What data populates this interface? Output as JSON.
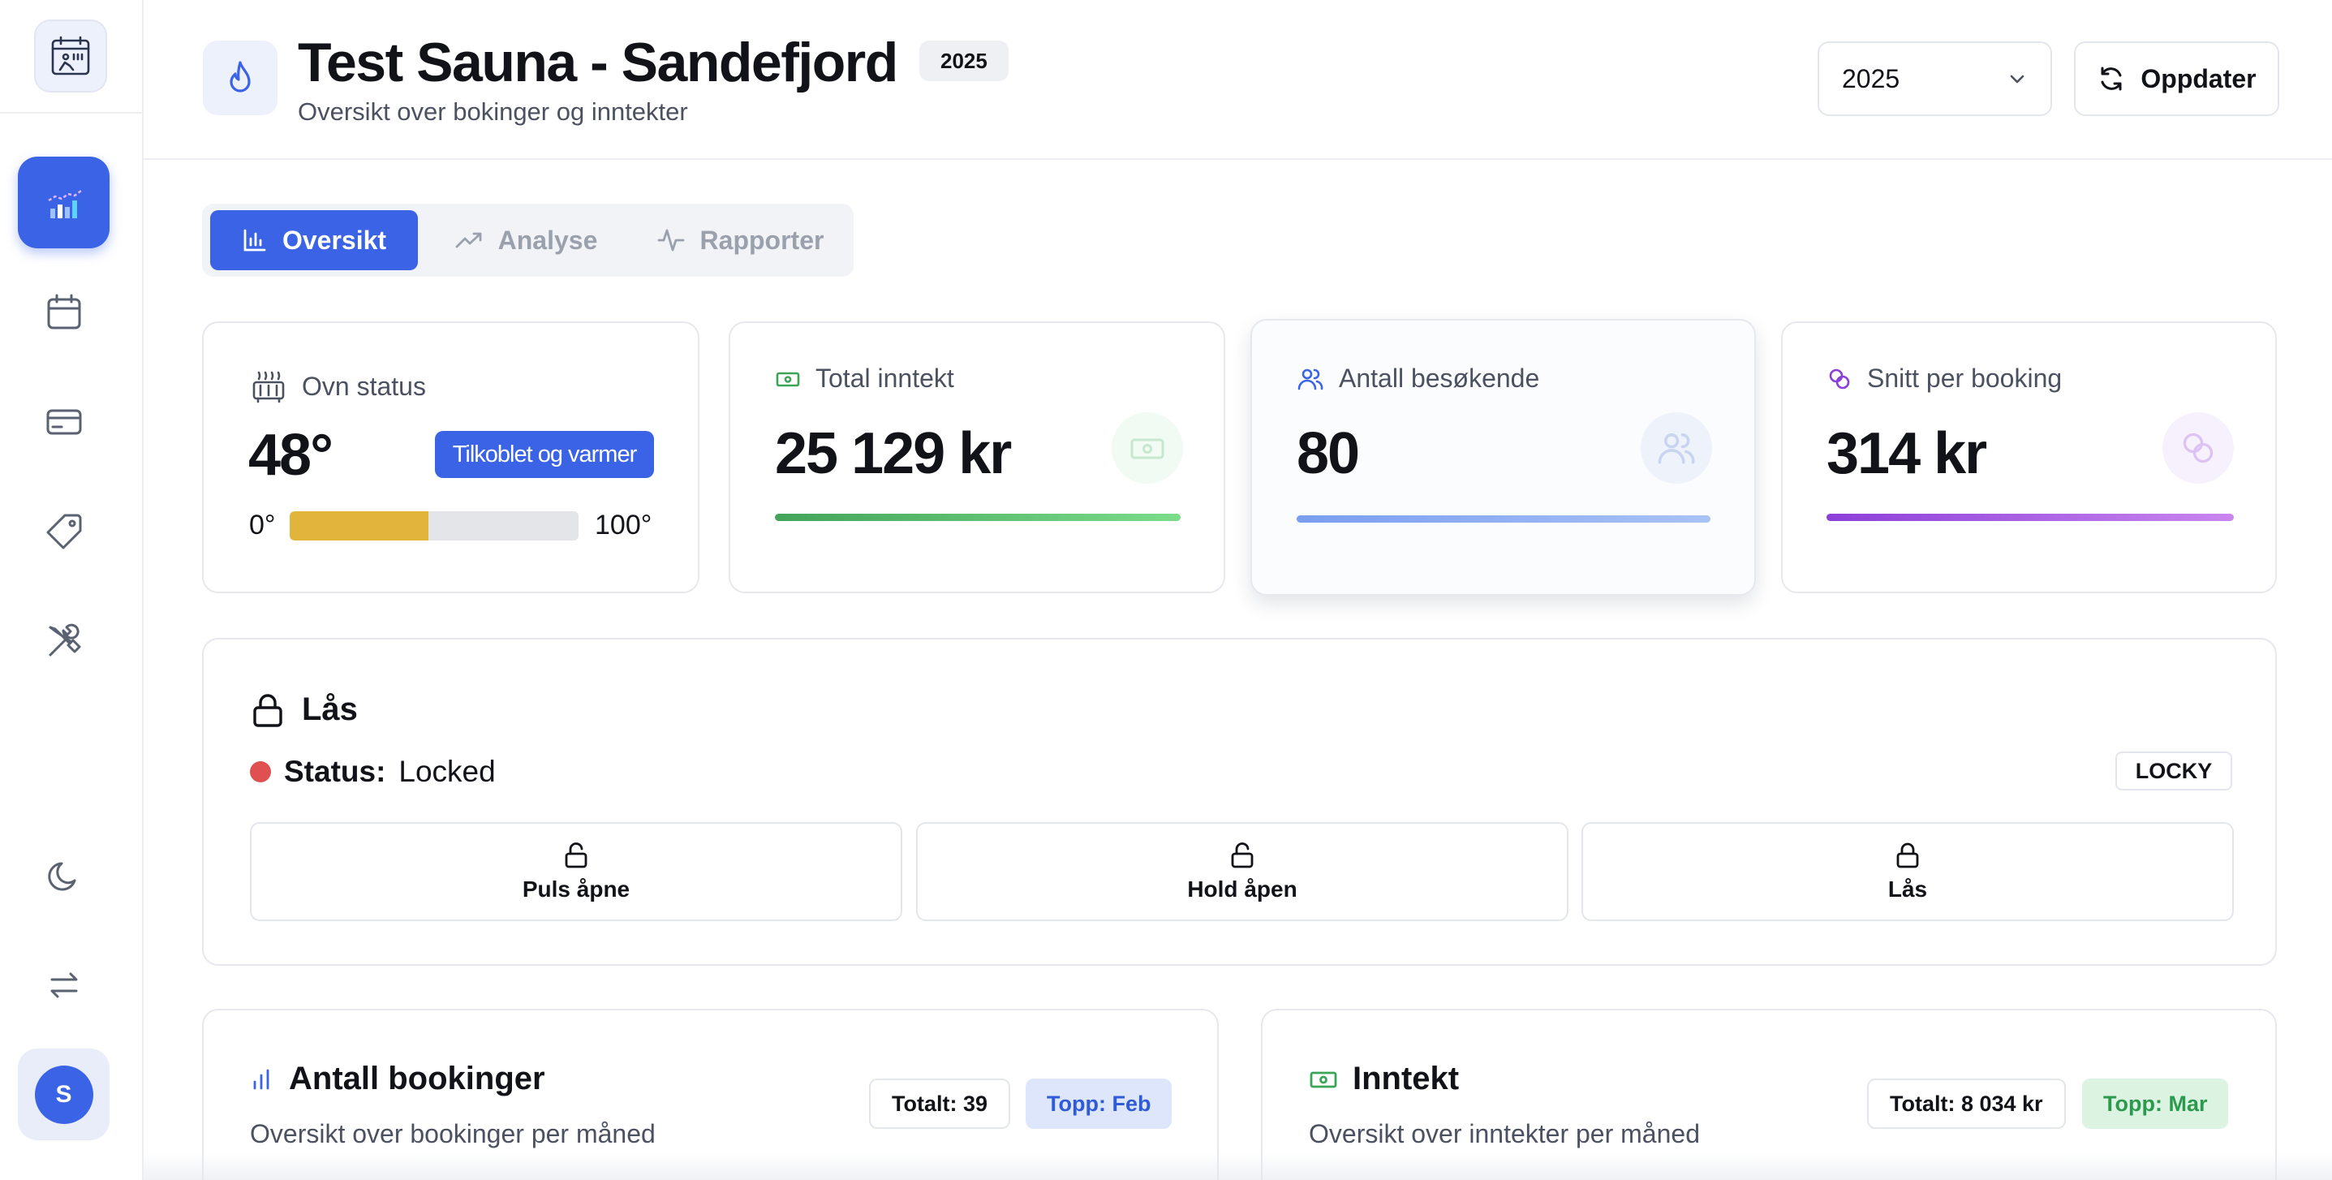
{
  "sidebar": {
    "logo_icon": "sauna-calendar-icon",
    "items": [
      {
        "name": "dashboard",
        "icon": "bar-chart-icon",
        "active": true
      },
      {
        "name": "calendar",
        "icon": "calendar-icon",
        "active": false
      },
      {
        "name": "payments",
        "icon": "credit-card-icon",
        "active": false
      },
      {
        "name": "pricing",
        "icon": "tag-icon",
        "active": false
      },
      {
        "name": "tools",
        "icon": "wrench-screwdriver-icon",
        "active": false
      }
    ],
    "bottom_items": [
      {
        "name": "theme",
        "icon": "moon-icon"
      },
      {
        "name": "switch",
        "icon": "swap-arrows-icon"
      }
    ],
    "avatar_initial": "S"
  },
  "header": {
    "title": "Test Sauna - Sandefjord",
    "year_badge": "2025",
    "subtitle": "Oversikt over bokinger og inntekter",
    "year_select": "2025",
    "refresh_label": "Oppdater"
  },
  "tabs": [
    {
      "label": "Oversikt",
      "active": true
    },
    {
      "label": "Analyse",
      "active": false
    },
    {
      "label": "Rapporter",
      "active": false
    }
  ],
  "stats": {
    "oven": {
      "label": "Ovn status",
      "value": "48°",
      "badge": "Tilkoblet og varmer",
      "min_label": "0°",
      "max_label": "100°",
      "level_percent": 48
    },
    "revenue": {
      "label": "Total inntekt",
      "value": "25 129 kr"
    },
    "visitors": {
      "label": "Antall besøkende",
      "value": "80"
    },
    "average": {
      "label": "Snitt per booking",
      "value": "314 kr"
    }
  },
  "lock": {
    "title": "Lås",
    "status_label": "Status:",
    "status_value": "Locked",
    "provider": "LOCKY",
    "buttons": [
      "Puls åpne",
      "Hold åpen",
      "Lås"
    ]
  },
  "bookings_panel": {
    "title": "Antall bookinger",
    "subtitle": "Oversikt over bookinger per måned",
    "total": "Totalt: 39",
    "top": "Topp: Feb"
  },
  "income_panel": {
    "title": "Inntekt",
    "subtitle": "Oversikt over inntekter per måned",
    "total": "Totalt: 8 034 kr",
    "top": "Topp: Mar"
  },
  "colors": {
    "accent": "#3b63e5",
    "green": "#4caf50",
    "purple": "#8b3fd9",
    "temp_fill": "#e3b43c",
    "status_locked": "#e05050"
  }
}
